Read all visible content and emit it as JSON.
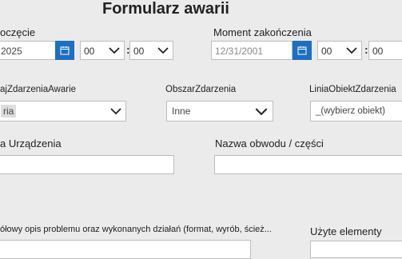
{
  "form": {
    "title": "Formularz awarii"
  },
  "start": {
    "label": "oczęcie",
    "date_value": "2025",
    "hour_value": "00",
    "minute_value": "00",
    "separator": ":"
  },
  "end": {
    "label": "Moment zakończenia",
    "date_value": "12/31/2001",
    "hour_value": "00",
    "minute_value": "00",
    "separator": ":"
  },
  "fields": {
    "rodzaj_label": "ajZdarzeniaAwarie",
    "rodzaj_value": "ria",
    "obszar_label": "ObszarZdarzenia",
    "obszar_value": "Inne",
    "linia_label": "LiniaObiektZdarzenia",
    "linia_value": "_(wybierz obiekt)",
    "nazwa_urzadzenia_label": "a Urządzenia",
    "nazwa_obwodu_label": "Nazwa obwodu / części",
    "opis_label": "ółowy opis problemu oraz wykonanych działań (format, wyrób, ścież...",
    "uzyte_label": "Użyte elementy"
  },
  "icons": {
    "calendar": "calendar-icon",
    "chevron": "chevron-down-icon"
  },
  "colors": {
    "accent": "#1e6fc0",
    "background": "#ebebeb"
  }
}
